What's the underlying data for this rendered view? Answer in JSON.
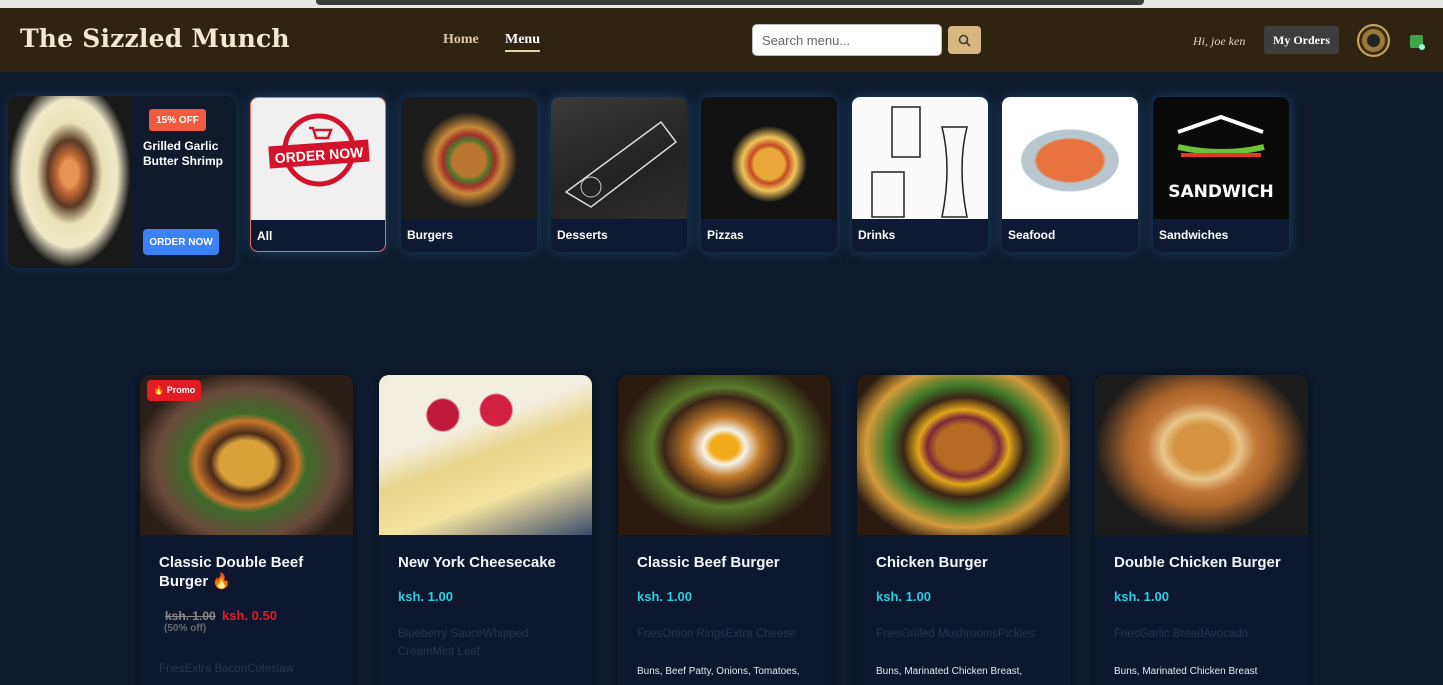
{
  "header": {
    "brand": "The Sizzled Munch",
    "nav": [
      "Home",
      "Menu"
    ],
    "active_nav": "Menu",
    "search_placeholder": "Search menu...",
    "search_button_icon": "search-icon",
    "greeting": "Hi, joe ken",
    "orders_label": "My Orders",
    "avatar_icon": "avatar",
    "cart_icon": "cart-icon"
  },
  "promo": {
    "badge": "15% OFF",
    "title": "Grilled Garlic Butter Shrimp",
    "button": "ORDER NOW"
  },
  "categories": [
    {
      "label": "All",
      "active": true
    },
    {
      "label": "Burgers"
    },
    {
      "label": "Desserts"
    },
    {
      "label": "Pizzas"
    },
    {
      "label": "Drinks"
    },
    {
      "label": "Seafood"
    },
    {
      "label": "Sandwiches"
    }
  ],
  "category_art_text": {
    "all": "ORDER NOW",
    "sandwiches": "SANDWICH"
  },
  "products": [
    {
      "tag": "🔥 Promo",
      "title": "Classic Double Beef Burger 🔥",
      "old_price": "ksh. 1.00",
      "new_price": "ksh. 0.50",
      "discount": "(50% off)",
      "extras": "FriesExtra BaconColeslaw",
      "ingredients": ""
    },
    {
      "title": "New York Cheesecake",
      "price": "ksh. 1.00",
      "extras": "Blueberry SauceWhipped CreamMint Leaf",
      "ingredients": ""
    },
    {
      "title": "Classic Beef Burger",
      "price": "ksh. 1.00",
      "extras": "FriesOnion RingsExtra Cheese",
      "ingredients": "Buns, Beef Patty, Onions, Tomatoes,"
    },
    {
      "title": "Chicken Burger",
      "price": "ksh. 1.00",
      "extras": "FriesGrilled MushroomsPickles",
      "ingredients": "Buns, Marinated Chicken Breast,"
    },
    {
      "title": "Double Chicken Burger",
      "price": "ksh. 1.00",
      "extras": "FriesGarlic BreadAvocado",
      "ingredients": "Buns, Marinated Chicken Breast"
    }
  ]
}
